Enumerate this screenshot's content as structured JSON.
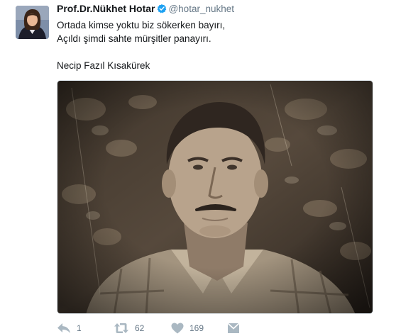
{
  "tweet": {
    "display_name": "Prof.Dr.Nükhet Hotar",
    "handle": "@hotar_nukhet",
    "verified": true,
    "lines": [
      "Ortada kimse yoktu biz sökerken bayırı,",
      "Açıldı şimdi sahte mürşitler panayırı.",
      "",
      "Necip Fazıl Kısakürek"
    ]
  },
  "actions": {
    "reply_count": "1",
    "retweet_count": "62",
    "like_count": "169"
  },
  "icons": {
    "reply": "reply-icon",
    "retweet": "retweet-icon",
    "like": "heart-icon",
    "message": "message-icon",
    "verified": "verified-badge-icon"
  },
  "colors": {
    "text": "#14171a",
    "muted": "#657786",
    "icon": "#aab8c2",
    "verified": "#1da1f2"
  }
}
